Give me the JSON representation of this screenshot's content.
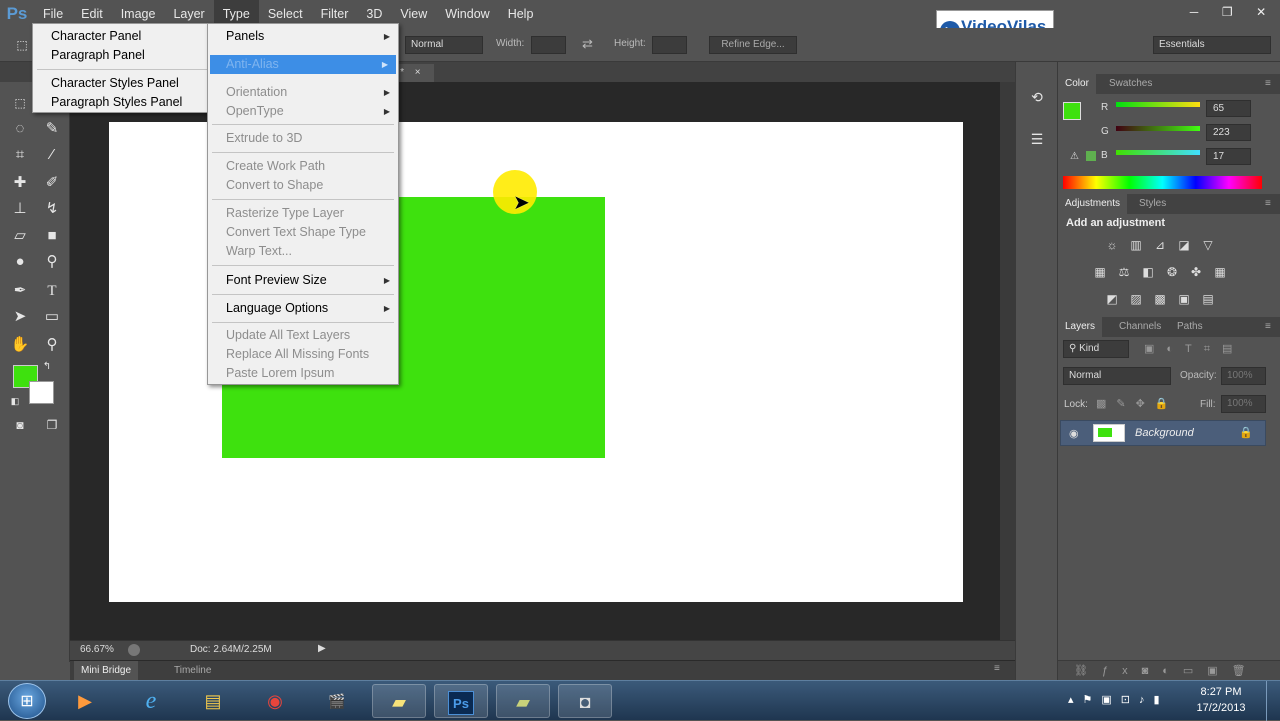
{
  "app": {
    "logo": "Ps",
    "menus": [
      "File",
      "Edit",
      "Image",
      "Layer",
      "Type",
      "Select",
      "Filter",
      "3D",
      "View",
      "Window",
      "Help"
    ],
    "active_menu": "Type",
    "window_controls": [
      "─",
      "❐",
      "✕"
    ]
  },
  "watermark": {
    "brand": "VideoVilas"
  },
  "options_bar": {
    "style_value": "Normal",
    "width_label": "Width:",
    "height_label": "Height:",
    "refine_edge": "Refine Edge...",
    "workspace": "Essentials"
  },
  "doc_tab": {
    "suffix": ") *",
    "close": "×"
  },
  "foreground_color": "#3ee10e",
  "status": {
    "zoom": "66.67%",
    "doc": "Doc: 2.64M/2.25M"
  },
  "bottom_tabs": [
    "Mini Bridge",
    "Timeline"
  ],
  "window_submenu": {
    "items": [
      "Character Panel",
      "Paragraph Panel",
      "Character Styles Panel",
      "Paragraph Styles Panel"
    ]
  },
  "type_menu": {
    "items": [
      {
        "label": "Panels",
        "disabled": false,
        "submenu": true
      },
      {
        "label": "Anti-Alias",
        "disabled": true,
        "submenu": true,
        "highlighted": true
      },
      {
        "label": "Orientation",
        "disabled": true,
        "submenu": true
      },
      {
        "label": "OpenType",
        "disabled": true,
        "submenu": true
      },
      {
        "label": "Extrude to 3D",
        "disabled": true
      },
      {
        "label": "Create Work Path",
        "disabled": true
      },
      {
        "label": "Convert to Shape",
        "disabled": true
      },
      {
        "label": "Rasterize Type Layer",
        "disabled": true
      },
      {
        "label": "Convert Text Shape Type",
        "disabled": true
      },
      {
        "label": "Warp Text...",
        "disabled": true
      },
      {
        "label": "Font Preview Size",
        "disabled": false,
        "submenu": true
      },
      {
        "label": "Language Options",
        "disabled": false,
        "submenu": true
      },
      {
        "label": "Update All Text Layers",
        "disabled": true
      },
      {
        "label": "Replace All Missing Fonts",
        "disabled": true
      },
      {
        "label": "Paste Lorem Ipsum",
        "disabled": true
      }
    ]
  },
  "color_panel": {
    "tabs": [
      "Color",
      "Swatches"
    ],
    "r_label": "R",
    "r": "65",
    "g_label": "G",
    "g": "223",
    "b_label": "B",
    "b": "17"
  },
  "adjustments_panel": {
    "tabs": [
      "Adjustments",
      "Styles"
    ],
    "title": "Add an adjustment"
  },
  "layers_panel": {
    "tabs": [
      "Layers",
      "Channels",
      "Paths"
    ],
    "kind": "Kind",
    "blend": "Normal",
    "opacity_label": "Opacity:",
    "opacity": "100%",
    "lock_label": "Lock:",
    "fill_label": "Fill:",
    "fill": "100%",
    "layer_name": "Background"
  },
  "taskbar": {
    "time": "8:27 PM",
    "date": "17/2/2013"
  }
}
